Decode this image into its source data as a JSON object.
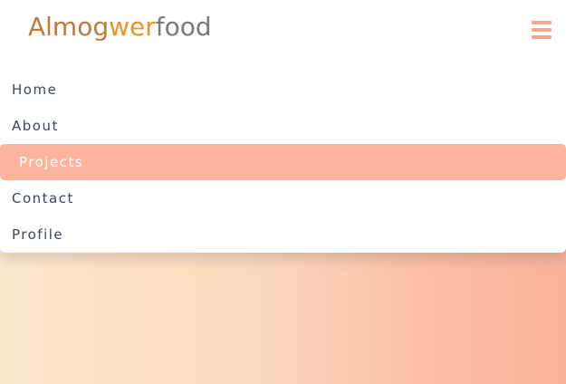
{
  "header": {
    "logo": {
      "part1": "Almog",
      "part2": "wer",
      "part3": "food"
    },
    "menu_icon": "hamburger-menu-icon"
  },
  "nav": {
    "items": [
      {
        "label": "Home",
        "active": false
      },
      {
        "label": "About",
        "active": false
      },
      {
        "label": "Projects",
        "active": true
      },
      {
        "label": "Contact",
        "active": false
      },
      {
        "label": "Profile",
        "active": false
      }
    ]
  },
  "colors": {
    "accent": "#fbb59f",
    "logo_part1": "#c1793a",
    "logo_part2": "#ec9422",
    "logo_part3": "#7a7a7a",
    "menu_text": "#3c4557",
    "hero_gradient_start": "#fde8cf",
    "hero_gradient_end": "#f9b39a"
  }
}
